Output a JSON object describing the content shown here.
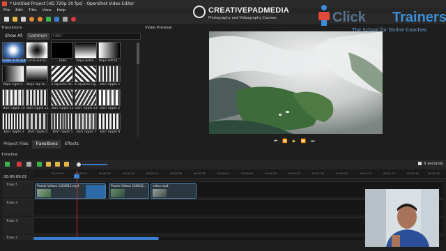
{
  "window": {
    "title": "* Untitled Project [HD 720p 30 fps] - OpenShot Video Editor"
  },
  "menu": [
    "File",
    "Edit",
    "Title",
    "View",
    "Help"
  ],
  "watermark": {
    "brand_name": "CREATIVEPADMEDIA",
    "brand_tagline": "Photography and Videography Courses",
    "ct_word1": "Click",
    "ct_word2": "Trainers",
    "ct_tagline": "The School for Online Coaches"
  },
  "transitions_panel": {
    "title": "Transitions",
    "filter_show_all": "Show All",
    "filter_common": "Common",
    "filter_placeholder": "Filter",
    "items": [
      "Circle in to out",
      "Circle out to...",
      "Fade",
      "Wipe botto...",
      "Wipe left to ...",
      "Wipe right t...",
      "Wipe top to ...",
      "4 squares lef...",
      "4 squares rig...",
      "Barr ripple 1",
      "Barr ripple 10",
      "Barr ripple 11",
      "Barr ripple 12",
      "Barr ripple 13",
      "Barr ripple 2",
      "Barr ripple 3",
      "Barr ripple 4",
      "Barr ripple 5",
      "Barr ripple 7",
      "Barr ripple 8"
    ]
  },
  "bottom_tabs": [
    "Project Files",
    "Transitions",
    "Effects"
  ],
  "preview": {
    "title": "Video Preview"
  },
  "timeline": {
    "title": "Timeline",
    "timecode": "00:00:09:01",
    "seconds_label": "5 seconds",
    "ruler_labels": [
      "00:00:05",
      "00:00:10",
      "00:00:15",
      "00:00:20",
      "00:00:25",
      "00:00:30",
      "00:00:35",
      "00:00:40",
      "00:00:45",
      "00:00:50",
      "00:00:55",
      "00:01:00",
      "00:01:05",
      "00:01:10",
      "00:01:15",
      "00:01:20",
      "00:01:25"
    ],
    "tracks": [
      "Track 5",
      "Track 4",
      "Track 3",
      "Track 2"
    ],
    "clips": [
      "Pexels Videos 1204911.mp4",
      "Pexels Videos 158045...",
      "video.mp4"
    ]
  }
}
